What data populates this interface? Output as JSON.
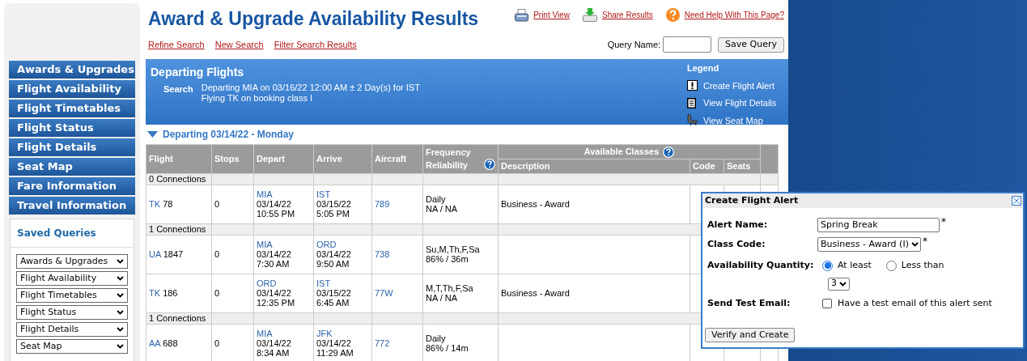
{
  "sidebar": {
    "nav_items": [
      "Awards & Upgrades",
      "Flight Availability",
      "Flight Timetables",
      "Flight Status",
      "Flight Details",
      "Seat Map",
      "Fare Information",
      "Travel Information"
    ],
    "saved_queries": {
      "title": "Saved Queries",
      "selects": [
        "Awards & Upgrades",
        "Flight Availability",
        "Flight Timetables",
        "Flight Status",
        "Flight Details",
        "Seat Map"
      ]
    }
  },
  "header": {
    "title": "Award & Upgrade Availability Results",
    "links": [
      "Refine Search",
      "New Search",
      "Filter Search Results"
    ],
    "actions": [
      {
        "kind": "print",
        "label": "Print View"
      },
      {
        "kind": "share",
        "label": "Share Results"
      },
      {
        "kind": "help",
        "label": "Need Help With This Page?"
      }
    ],
    "query_name_label": "Query Name:",
    "save_button": "Save Query"
  },
  "search_panel": {
    "title": "Departing Flights",
    "search_label": "Search",
    "search_lines": [
      "Departing MIA on 03/16/22 12:00 AM ± 2 Day(s) for IST",
      "Flying TK on booking class I"
    ],
    "legend": {
      "title": "Legend",
      "items": [
        {
          "kind": "alert",
          "label": "Create Flight Alert"
        },
        {
          "kind": "details",
          "label": "View Flight Details"
        },
        {
          "kind": "seat",
          "label": "View Seat Map"
        }
      ]
    }
  },
  "day_heading": "Departing 03/14/22 - Monday",
  "table": {
    "columns": [
      "Flight",
      "Stops",
      "Depart",
      "Arrive",
      "Aircraft",
      "Frequency Reliability"
    ],
    "group_header": "Available Classes",
    "sub_columns": [
      "Description",
      "Code",
      "Seats"
    ],
    "rows": [
      {
        "kind": "group",
        "label": "0 Connections"
      },
      {
        "kind": "flight",
        "airline": "TK",
        "number": "78",
        "stops": "0",
        "depart": {
          "airport": "MIA",
          "date": "03/14/22",
          "time": "10:55 PM"
        },
        "arrive": {
          "airport": "IST",
          "date": "03/15/22",
          "time": "5:05 PM"
        },
        "aircraft": "789",
        "frequency": "Daily",
        "reliability": "NA / NA",
        "description": "Business - Award"
      },
      {
        "kind": "group",
        "label": "1 Connections"
      },
      {
        "kind": "flight",
        "airline": "UA",
        "number": "1847",
        "stops": "0",
        "depart": {
          "airport": "MIA",
          "date": "03/14/22",
          "time": "7:30 AM"
        },
        "arrive": {
          "airport": "ORD",
          "date": "03/14/22",
          "time": "9:50 AM"
        },
        "aircraft": "738",
        "frequency": "Su,M,Th,F,Sa",
        "reliability": "86% / 36m"
      },
      {
        "kind": "flight",
        "airline": "TK",
        "number": "186",
        "stops": "0",
        "depart": {
          "airport": "ORD",
          "date": "03/14/22",
          "time": "12:35 PM"
        },
        "arrive": {
          "airport": "IST",
          "date": "03/15/22",
          "time": "6:45 AM"
        },
        "aircraft": "77W",
        "frequency": "M,T,Th,F,Sa",
        "reliability": "NA / NA",
        "description": "Business - Award"
      },
      {
        "kind": "group",
        "label": "1 Connections"
      },
      {
        "kind": "flight",
        "airline": "AA",
        "number": "688",
        "stops": "0",
        "depart": {
          "airport": "MIA",
          "date": "03/14/22",
          "time": "8:34 AM"
        },
        "arrive": {
          "airport": "JFK",
          "date": "03/14/22",
          "time": "11:29 AM"
        },
        "aircraft": "772",
        "frequency": "Daily",
        "reliability": "86% / 14m"
      }
    ]
  },
  "dialog": {
    "title": "Create Flight Alert",
    "alert_name_label": "Alert Name:",
    "alert_name": "Spring Break",
    "required_mark": "*",
    "class_code_label": "Class Code:",
    "class_code": "Business - Award (I)",
    "quantity_label": "Availability Quantity:",
    "quantity_options": [
      {
        "label": "At least",
        "selected": true
      },
      {
        "label": "Less than",
        "selected": false
      }
    ],
    "quantity": "3",
    "test_email_label": "Send Test Email:",
    "test_email": {
      "label": "Have a test email of this alert sent",
      "checked": false
    },
    "submit": "Verify and Create"
  }
}
